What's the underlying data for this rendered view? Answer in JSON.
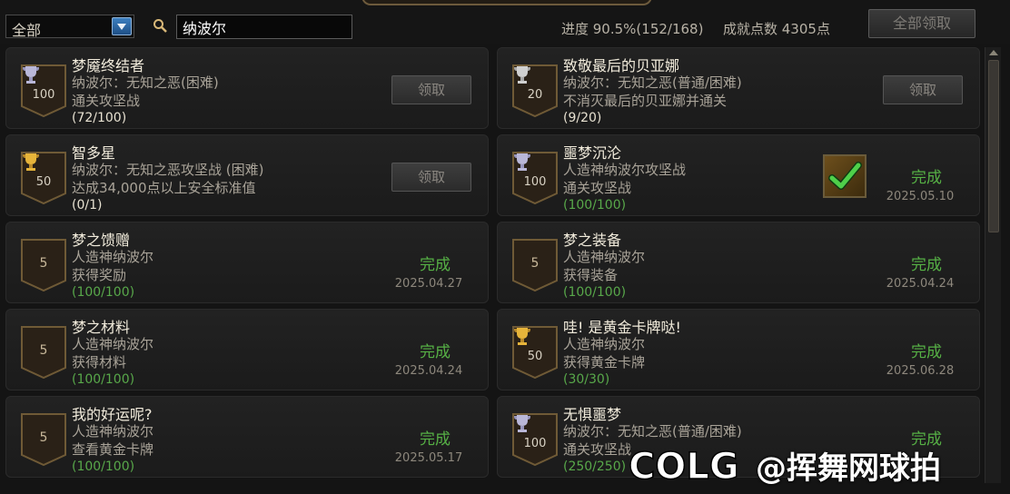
{
  "filter": {
    "selected": "全部"
  },
  "search": {
    "value": "纳波尔"
  },
  "summary": {
    "progress": "进度 90.5%(152/168)",
    "points": "成就点数 4305点"
  },
  "claim_all_label": "全部领取",
  "achievements": [
    {
      "title": "梦魇终结者",
      "line1": "纳波尔：无知之恶(困难)",
      "line2": "通关攻坚战",
      "count": "(72/100)",
      "points": "100",
      "cup": "silver",
      "claim_label": "领取"
    },
    {
      "title": "致敬最后的贝亚娜",
      "line1": "纳波尔：无知之恶(普通/困难)",
      "line2": "不消灭最后的贝亚娜并通关",
      "count": "(9/20)",
      "points": "20",
      "cup": "silver",
      "claim_label": "领取"
    },
    {
      "title": "智多星",
      "line1": "纳波尔：无知之恶攻坚战 (困难)",
      "line2": "达成34,000点以上安全标准值",
      "count": "(0/1)",
      "points": "50",
      "cup": "gold",
      "claim_label": "领取"
    },
    {
      "title": "噩梦沉沦",
      "line1": "人造神纳波尔攻坚战",
      "line2": "通关攻坚战",
      "count": "(100/100)",
      "points": "100",
      "cup": "silver",
      "status": "完成",
      "date": "2025.05.10"
    },
    {
      "title": "梦之馈赠",
      "line1": "人造神纳波尔",
      "line2": "获得奖励",
      "count": "(100/100)",
      "points": "5",
      "status": "完成",
      "date": "2025.04.27"
    },
    {
      "title": "梦之装备",
      "line1": "人造神纳波尔",
      "line2": "获得装备",
      "count": "(100/100)",
      "points": "5",
      "status": "完成",
      "date": "2025.04.24"
    },
    {
      "title": "梦之材料",
      "line1": "人造神纳波尔",
      "line2": "获得材料",
      "count": "(100/100)",
      "points": "5",
      "status": "完成",
      "date": "2025.04.24"
    },
    {
      "title": "哇! 是黄金卡牌哒!",
      "line1": "人造神纳波尔",
      "line2": "获得黄金卡牌",
      "count": "(30/30)",
      "points": "50",
      "cup": "gold",
      "status": "完成",
      "date": "2025.06.28"
    },
    {
      "title": "我的好运呢?",
      "line1": "人造神纳波尔",
      "line2": "查看黄金卡牌",
      "count": "(100/100)",
      "points": "5",
      "status": "完成",
      "date": "2025.05.17"
    },
    {
      "title": "无惧噩梦",
      "line1": "纳波尔：无知之恶(普通/困难)",
      "line2": "通关攻坚战",
      "count": "(250/250)",
      "points": "100",
      "cup": "silver",
      "status": "完成"
    }
  ],
  "watermark": {
    "logo": "COLG",
    "text": "@挥舞网球拍"
  },
  "colors": {
    "complete": "#56b045",
    "background": "#141414",
    "card": "#1f1f1f"
  }
}
